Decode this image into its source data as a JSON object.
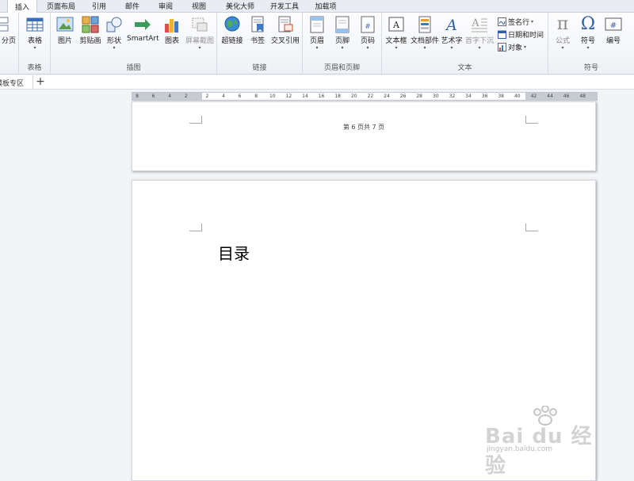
{
  "menu_tabs": [
    "插入",
    "页面布局",
    "引用",
    "邮件",
    "审阅",
    "视图",
    "美化大师",
    "开发工具",
    "加载项"
  ],
  "ribbon": {
    "partial_left_label": "分页",
    "groups": {
      "table": "表格",
      "illustration": "插图",
      "links": "链接",
      "header_footer": "页眉和页脚",
      "text": "文本",
      "symbols": "符号"
    },
    "buttons": {
      "table": "表格",
      "picture": "图片",
      "clipart": "剪贴画",
      "shapes": "形状",
      "smartart": "SmartArt",
      "chart": "图表",
      "screenshot": "屏幕截图",
      "hyperlink": "超链接",
      "bookmark": "书签",
      "crossref": "交叉引用",
      "header": "页眉",
      "footer": "页脚",
      "page_number": "页码",
      "textbox": "文本框",
      "quickparts": "文档部件",
      "wordart": "艺术字",
      "dropcap": "首字下沉",
      "signature": "签名行",
      "datetime": "日期和时间",
      "object": "对象",
      "equation": "公式",
      "symbol": "符号",
      "numbering": "编号"
    }
  },
  "doc_tab": {
    "label": "模板专区",
    "add": "+"
  },
  "ruler_labels": [
    "8",
    "6",
    "4",
    "2",
    "2",
    "4",
    "6",
    "8",
    "10",
    "12",
    "14",
    "16",
    "18",
    "20",
    "22",
    "24",
    "26",
    "28",
    "30",
    "32",
    "34",
    "36",
    "38",
    "40",
    "42",
    "44",
    "46",
    "48"
  ],
  "page1_footer": "第 6 页共 7 页",
  "page2_heading": "目录",
  "watermark": {
    "text": "Bai du 经验",
    "url": "jingyan.baidu.com"
  },
  "colors": {
    "accent_blue": "#2f6fc9",
    "page_bg": "#ffffff",
    "workspace_bg": "#f3f4f6"
  }
}
